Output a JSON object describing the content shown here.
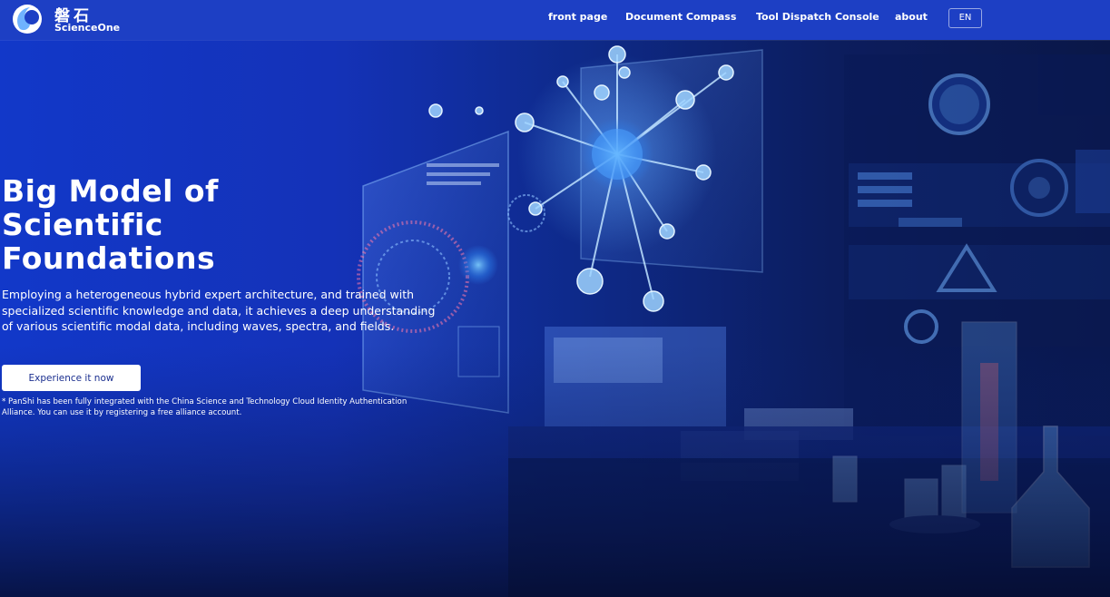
{
  "brand": {
    "name_cn": "磐石",
    "name_en": "ScienceOne",
    "logo_icon": "scienceone-logo-icon"
  },
  "nav": {
    "items": [
      {
        "label": "front page"
      },
      {
        "label": "Document Compass"
      },
      {
        "label": "Tool Dispatch Console"
      },
      {
        "label": "about"
      }
    ],
    "lang_label": "EN"
  },
  "hero": {
    "title_lines": [
      "Big Model of",
      "Scientific",
      "Foundations"
    ],
    "description": "Employing a heterogeneous hybrid expert architecture, and trained with specialized scientific knowledge and data, it achieves a deep understanding of various scientific modal data, including waves, spectra, and fields.",
    "cta_label": "Experience it now",
    "footnote": "* PanShi has been fully integrated with the China Science and Technology Cloud Identity Authentication Alliance. You can use it by registering a free alliance account."
  },
  "colors": {
    "header_bg": "#1d3fc4",
    "hero_blue": "#1238c9",
    "text": "#ffffff",
    "cta_text": "#1b2f8f"
  },
  "background_image": "laboratory-scene-with-holographic-virus-model"
}
